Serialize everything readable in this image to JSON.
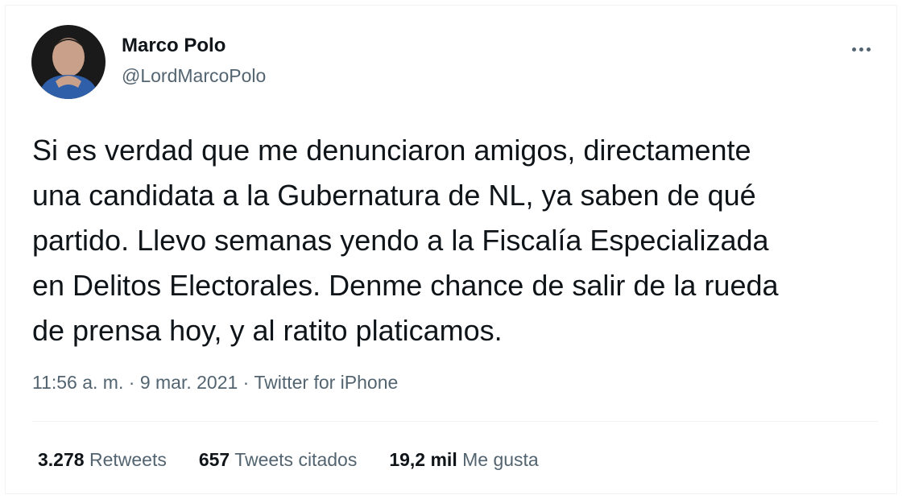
{
  "author": {
    "name": "Marco Polo",
    "handle": "@LordMarcoPolo"
  },
  "tweet": {
    "text": "Si es verdad que me denunciaron amigos, directamente\nuna candidata a la Gubernatura de NL, ya saben de qué\npartido. Llevo semanas yendo a la Fiscalía Especializada\nen Delitos Electorales. Denme chance de salir de la rueda\nde prensa hoy, y al ratito platicamos."
  },
  "meta": {
    "time": "11:56 a. m.",
    "separator": " · ",
    "date": "9 mar. 2021",
    "source": "Twitter for iPhone"
  },
  "stats": {
    "retweets_count": "3.278",
    "retweets_label": "Retweets",
    "quotes_count": "657",
    "quotes_label": "Tweets citados",
    "likes_count": "19,2 mil",
    "likes_label": "Me gusta"
  },
  "colors": {
    "text": "#0f1419",
    "secondary": "#536471",
    "border": "#eff3f4"
  },
  "icons": {
    "more": "more-horizontal-icon"
  }
}
